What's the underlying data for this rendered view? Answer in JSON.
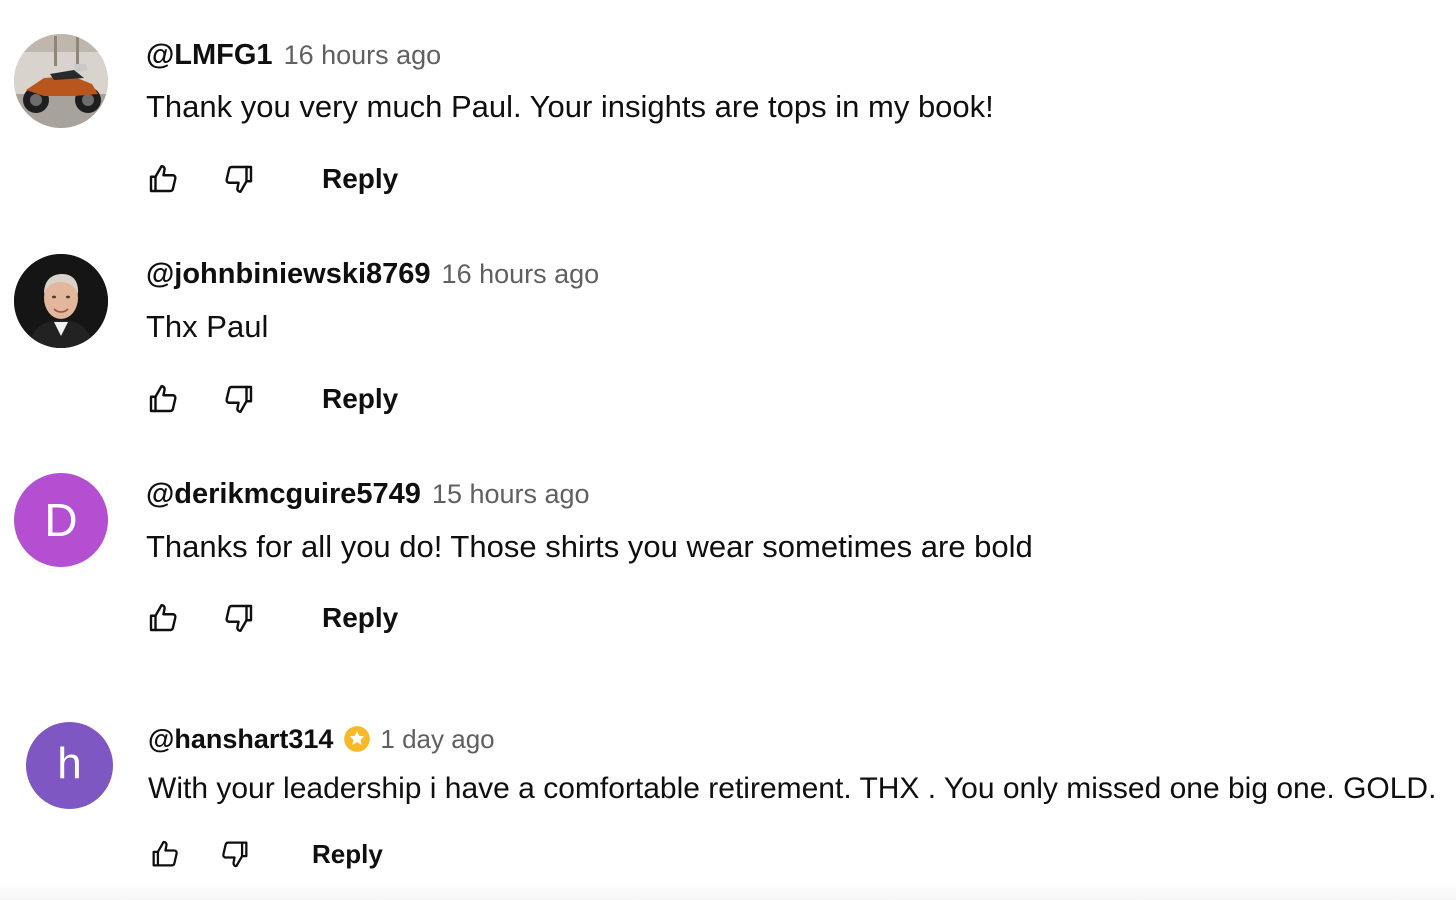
{
  "colors": {
    "author": "#0f0f0f",
    "timestamp": "#606060",
    "avatar_d": "#b34fd0",
    "avatar_h": "#7e57c2",
    "badge_star": "#f7b928"
  },
  "comments": [
    {
      "author": "@LMFG1",
      "time": "16 hours ago",
      "text": "Thank you very much Paul. Your insights are tops in my book!",
      "avatar": "motorcycle-photo",
      "reply_label": "Reply"
    },
    {
      "author": "@johnbiniewski8769",
      "time": "16 hours ago",
      "text": "Thx Paul",
      "avatar": "portrait-photo",
      "reply_label": "Reply"
    },
    {
      "author": "@derikmcguire5749",
      "time": "15 hours ago",
      "text": "Thanks for all you do! Those shirts you wear sometimes are bold",
      "avatar_letter": "D",
      "reply_label": "Reply"
    },
    {
      "author": "@hanshart314",
      "time": "1 day ago",
      "text": "With your leadership i have a comfortable retirement. THX . You only missed one big one. GOLD.",
      "avatar_letter": "h",
      "badge": "member-star-badge-icon",
      "reply_label": "Reply"
    }
  ],
  "icons": {
    "like": "thumbs-up-icon",
    "dislike": "thumbs-down-icon"
  }
}
